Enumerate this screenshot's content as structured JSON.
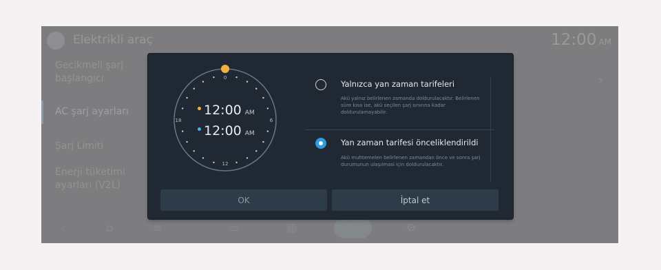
{
  "background_app": {
    "title": "Elektrikli araç",
    "time": "12:00",
    "time_ampm": "AM",
    "sidebar": [
      {
        "label": "Gecikmeli şarj başlangıcı"
      },
      {
        "label": "AC şarj ayarları"
      },
      {
        "label": "Şarj Limiti"
      },
      {
        "label": "Enerji tüketimi ayarları (V2L)"
      }
    ]
  },
  "dialog": {
    "clock": {
      "labels": [
        "0",
        "6",
        "12",
        "18"
      ],
      "start_time": "12:00",
      "start_ampm": "AM",
      "end_time": "12:00",
      "end_ampm": "AM",
      "start_color": "#f2b13f",
      "end_color": "#3fb7e6"
    },
    "options": [
      {
        "title": "Yalnızca yan zaman tarifeleri",
        "description": "Akü yalnız belirlenen zamanda doldurulacaktır. Belirlenen süre kısa ise, akü seçilen şarj sınırına kadar doldurulamayabilir.",
        "selected": false
      },
      {
        "title": "Yan zaman tarifesi önceliklendirildi",
        "description": "Akü muhtemelen belirlenen zamandan önce ve sonra şarj durumunun ulaşılmasi için doldurulacaktır.",
        "selected": true
      }
    ],
    "buttons": {
      "ok": "OK",
      "cancel": "İptal et"
    }
  },
  "colors": {
    "dialog_bg": "#1f2833",
    "accent_blue": "#2f9bd7",
    "accent_orange": "#f2b13f"
  }
}
